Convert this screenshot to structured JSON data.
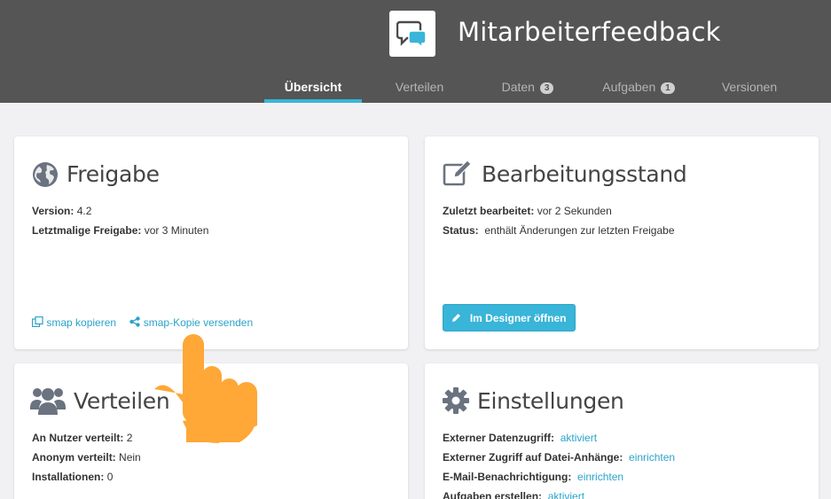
{
  "header": {
    "title": "Mitarbeiterfeedback",
    "logo_icon": "chat-bubbles-icon",
    "bg_color": "#555555",
    "accent_color": "#38b5d8"
  },
  "tabs": [
    {
      "label": "Übersicht",
      "active": true
    },
    {
      "label": "Verteilen"
    },
    {
      "label": "Daten",
      "badge": "3"
    },
    {
      "label": "Aufgaben",
      "badge": "1"
    },
    {
      "label": "Versionen"
    }
  ],
  "freigabe": {
    "title": "Freigabe",
    "icon": "globe-icon",
    "version_label": "Version:",
    "version_value": "4.2",
    "last_release_label": "Letztmalige Freigabe:",
    "last_release_value": "vor 3 Minuten",
    "copy_link": "smap kopieren",
    "share_link": "smap-Kopie versenden"
  },
  "bearbeitung": {
    "title": "Bearbeitungsstand",
    "icon": "edit-icon",
    "last_edited_label": "Zuletzt bearbeitet:",
    "last_edited_value": "vor 2 Sekunden",
    "status_label": "Status:",
    "status_value": "enthält Änderungen zur letzten Freigabe",
    "designer_button": "Im Designer öffnen"
  },
  "verteilen": {
    "title": "Verteilen",
    "icon": "users-icon",
    "users_label": "An Nutzer verteilt:",
    "users_value": "2",
    "anon_label": "Anonym verteilt:",
    "anon_value": "Nein",
    "installs_label": "Installationen:",
    "installs_value": "0"
  },
  "einstellungen": {
    "title": "Einstellungen",
    "icon": "gear-icon",
    "rows": [
      {
        "label": "Externer Datenzugriff:",
        "value": "aktiviert"
      },
      {
        "label": "Externer Zugriff auf Datei-Anhänge:",
        "value": "einrichten"
      },
      {
        "label": "E-Mail-Benachrichtigung:",
        "value": "einrichten"
      },
      {
        "label": "Aufgaben erstellen:",
        "value": "aktiviert"
      }
    ]
  },
  "overlay": {
    "icon": "pointing-hand-icon",
    "color": "#ffa737"
  }
}
